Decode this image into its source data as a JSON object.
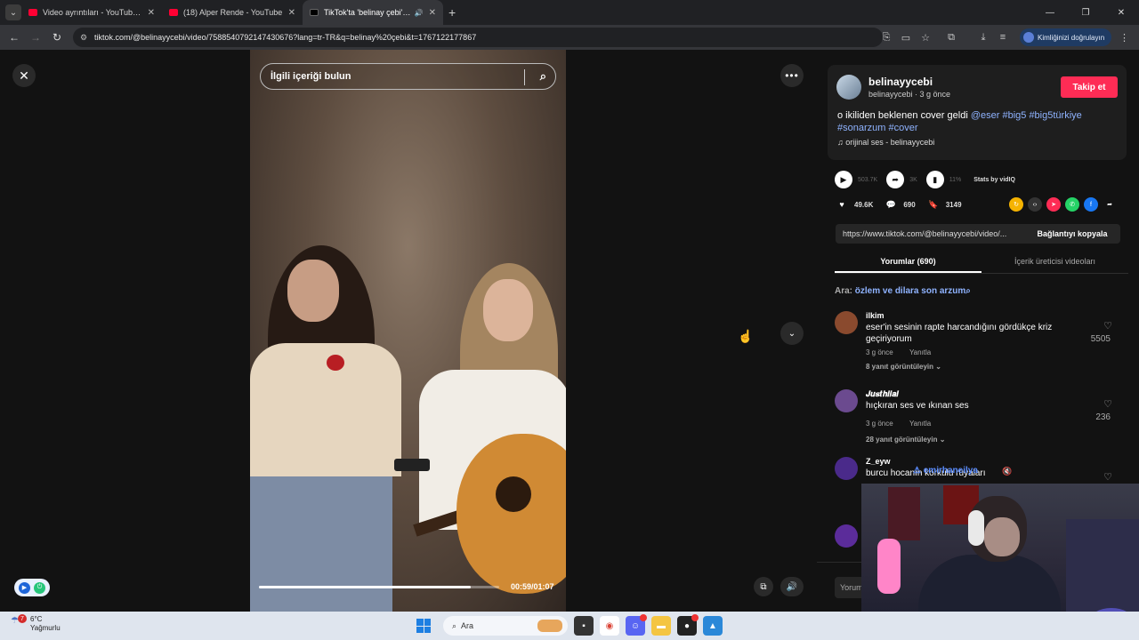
{
  "browser": {
    "tabs": [
      {
        "title": "Video ayrıntıları - YouTube Studio",
        "favicon": "youtube-icon",
        "active": false
      },
      {
        "title": "(18) Alper Rende - YouTube",
        "favicon": "youtube-icon",
        "active": false
      },
      {
        "title": "TikTok'ta 'belinay çebi' bulun",
        "favicon": "tiktok-icon",
        "active": true
      }
    ],
    "url": "tiktok.com/@belinayycebi/video/7588540792147430676?lang=tr-TR&q=belinay%20çebi&t=1767122177867",
    "profile_label": "Kimliğinizi doğrulayın"
  },
  "video": {
    "search_placeholder": "İlgili içeriği bulun",
    "time": "00:59/01:07",
    "progress": 0.88
  },
  "post": {
    "username": "belinayycebi",
    "meta": "belinayycebi · 3 g önce",
    "follow_label": "Takip et",
    "caption_text": "o ikiliden beklenen cover geldi ",
    "caption_mention": "@eser",
    "caption_tags_1": "#big5 #big5türkiye",
    "caption_tags_2": "#sonarzum #cover",
    "sound": "orijinal ses - belinayycebi"
  },
  "stats": {
    "views": "503.7K",
    "shares": "3K",
    "engagement": "11%",
    "vidiq_label": "Stats by vidIQ"
  },
  "actions": {
    "likes": "49.6K",
    "comments": "690",
    "saves": "3149"
  },
  "link": {
    "url": "https://www.tiktok.com/@belinayycebi/video/...",
    "copy_label": "Bağlantıyı kopyala"
  },
  "tabs": {
    "comments": "Yorumlar (690)",
    "creator_videos": "İçerik üreticisi videoları"
  },
  "search_hint": {
    "prefix": "Ara: ",
    "query": "özlem ve dilara son arzum"
  },
  "comments": [
    {
      "user": "ilkim",
      "text": "eser'in sesinin rapte harcandığını gördükçe kriz geçiriyorum",
      "time": "3 g önce",
      "reply": "Yanıtla",
      "replies": "8 yanıt görüntüleyin",
      "likes": "5505"
    },
    {
      "user": "𝑱𝒖𝒔𝒕𝒉𝒊𝒍𝒂𝒍",
      "text": "hıçkıran ses ve ıkınan ses",
      "time": "3 g önce",
      "reply": "Yanıtla",
      "replies": "28 yanıt görüntüleyin",
      "likes": "236"
    },
    {
      "user": "Z_eyw",
      "text": "burcu hocanın korkulu rüyaları",
      "time": "",
      "reply": "",
      "replies": "",
      "likes": ""
    }
  ],
  "overlay_name": "emirhaneilya",
  "comment_input": "Yorum",
  "taskbar": {
    "temp": "6°C",
    "condition": "Yağmurlu",
    "badge": "7",
    "search": "Ara"
  }
}
